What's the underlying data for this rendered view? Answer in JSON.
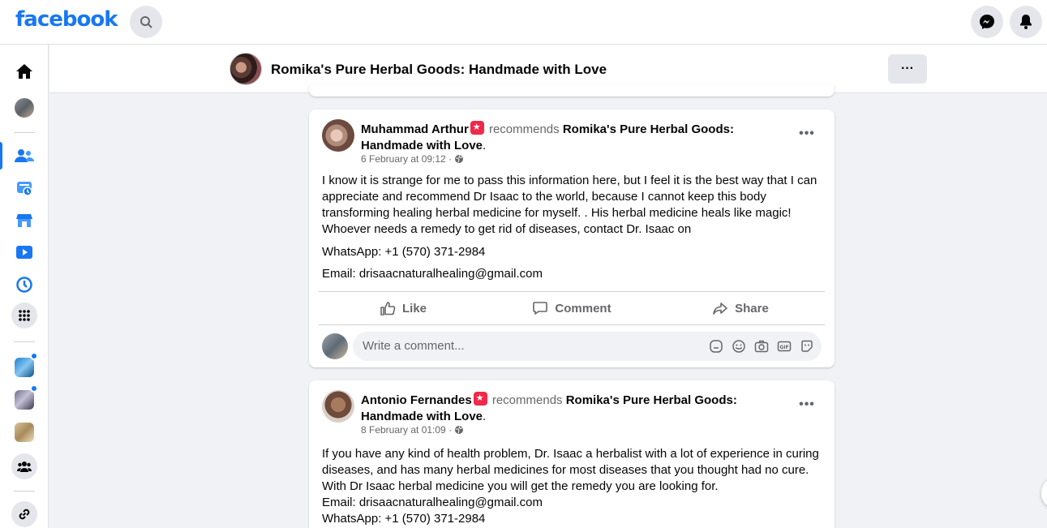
{
  "topbar": {
    "logo": "facebook",
    "search_icon": "search-icon",
    "messenger_icon": "messenger-icon",
    "notifications_icon": "bell-icon"
  },
  "leftrail": {
    "items": [
      {
        "name": "home-icon"
      },
      {
        "name": "profile-avatar"
      },
      {
        "name": "friends-icon",
        "active": true
      },
      {
        "name": "memories-icon"
      },
      {
        "name": "marketplace-icon"
      },
      {
        "name": "watch-icon"
      },
      {
        "name": "recent-icon"
      },
      {
        "name": "menu-grid-icon"
      },
      {
        "name": "group-shortcut-1",
        "badge": true
      },
      {
        "name": "group-shortcut-2",
        "badge": true
      },
      {
        "name": "group-shortcut-3"
      },
      {
        "name": "groups-icon"
      },
      {
        "name": "link-icon"
      }
    ]
  },
  "pagehead": {
    "title": "Romika's Pure Herbal Goods: Handmade with Love",
    "more_label": "···"
  },
  "posts": [
    {
      "author": "Muhammad Arthur",
      "verb": "recommends",
      "page": "Romika's Pure Herbal Goods: Handmade with Love",
      "period": ".",
      "timestamp": "6 February at 09:12 · ",
      "paragraphs": [
        "I know it is strange for me to pass this information here, but I feel it is the best way that I can appreciate and recommend Dr Isaac to the world, because I cannot keep this body transforming healing herbal medicine for myself. . His herbal medicine heals like magic! Whoever needs a remedy to get rid of diseases, contact Dr. Isaac on",
        "WhatsApp: +1 (570) 371-2984",
        "Email: drisaacnaturalhealing@gmail.com"
      ],
      "actions": {
        "like": "Like",
        "comment": "Comment",
        "share": "Share"
      },
      "comment_placeholder": "Write a comment..."
    },
    {
      "author": "Antonio Fernandes",
      "verb": "recommends",
      "page": "Romika's Pure Herbal Goods: Handmade with Love",
      "period": ".",
      "timestamp": "8 February at 01:09 · ",
      "lines": [
        "If you have any kind of health problem, Dr. Isaac a herbalist with a lot of experience in curing diseases, and has many herbal medicines for most diseases that you thought had no cure.",
        "With Dr Isaac herbal medicine you will get the remedy you are looking for.",
        "Email: drisaacnaturalhealing@gmail.com",
        "WhatsApp: +1 (570) 371-2984"
      ]
    }
  ],
  "colors": {
    "brand": "#1877f2",
    "badge": "#f02849",
    "muted": "#65676b",
    "background": "#f0f2f5"
  }
}
